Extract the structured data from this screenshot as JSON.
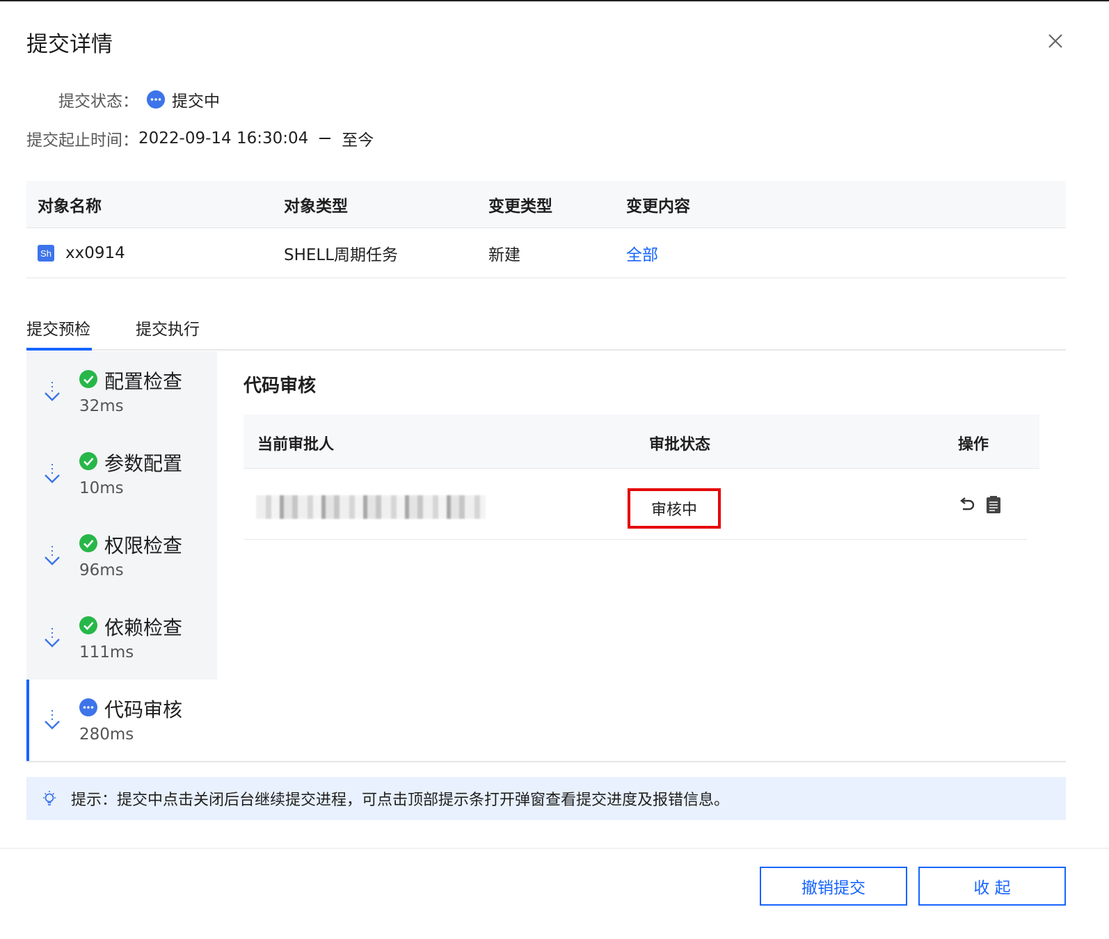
{
  "dialog": {
    "title": "提交详情",
    "close_icon": "close-icon"
  },
  "meta": {
    "status_label": "提交状态：",
    "status_value": "提交中",
    "time_label": "提交起止时间：",
    "time_start": "2022-09-14 16:30:04",
    "time_end": "至今"
  },
  "objects": {
    "columns": [
      "对象名称",
      "对象类型",
      "变更类型",
      "变更内容"
    ],
    "rows": [
      {
        "badge": "Sh",
        "name": "xx0914",
        "type": "SHELL周期任务",
        "change_type": "新建",
        "change_content": "全部"
      }
    ]
  },
  "tabs": [
    {
      "label": "提交预检",
      "active": true
    },
    {
      "label": "提交执行",
      "active": false
    }
  ],
  "steps": [
    {
      "name": "配置检查",
      "duration": "32ms",
      "status": "success"
    },
    {
      "name": "参数配置",
      "duration": "10ms",
      "status": "success"
    },
    {
      "name": "权限检查",
      "duration": "96ms",
      "status": "success"
    },
    {
      "name": "依赖检查",
      "duration": "111ms",
      "status": "success"
    },
    {
      "name": "代码审核",
      "duration": "280ms",
      "status": "in-progress"
    }
  ],
  "review": {
    "title": "代码审核",
    "columns": [
      "当前审批人",
      "审批状态",
      "操作"
    ],
    "rows": [
      {
        "approver": "",
        "status": "审核中"
      }
    ]
  },
  "tip": {
    "text": "提示：提交中点击关闭后台继续提交进程，可点击顶部提示条打开弹窗查看提交进度及报错信息。"
  },
  "footer": {
    "cancel_label": "撤销提交",
    "collapse_label": "收 起"
  },
  "colors": {
    "accent": "#1664ff",
    "success": "#27b748",
    "highlight_border": "#e50000",
    "tip_bg": "#e8f1fd"
  }
}
